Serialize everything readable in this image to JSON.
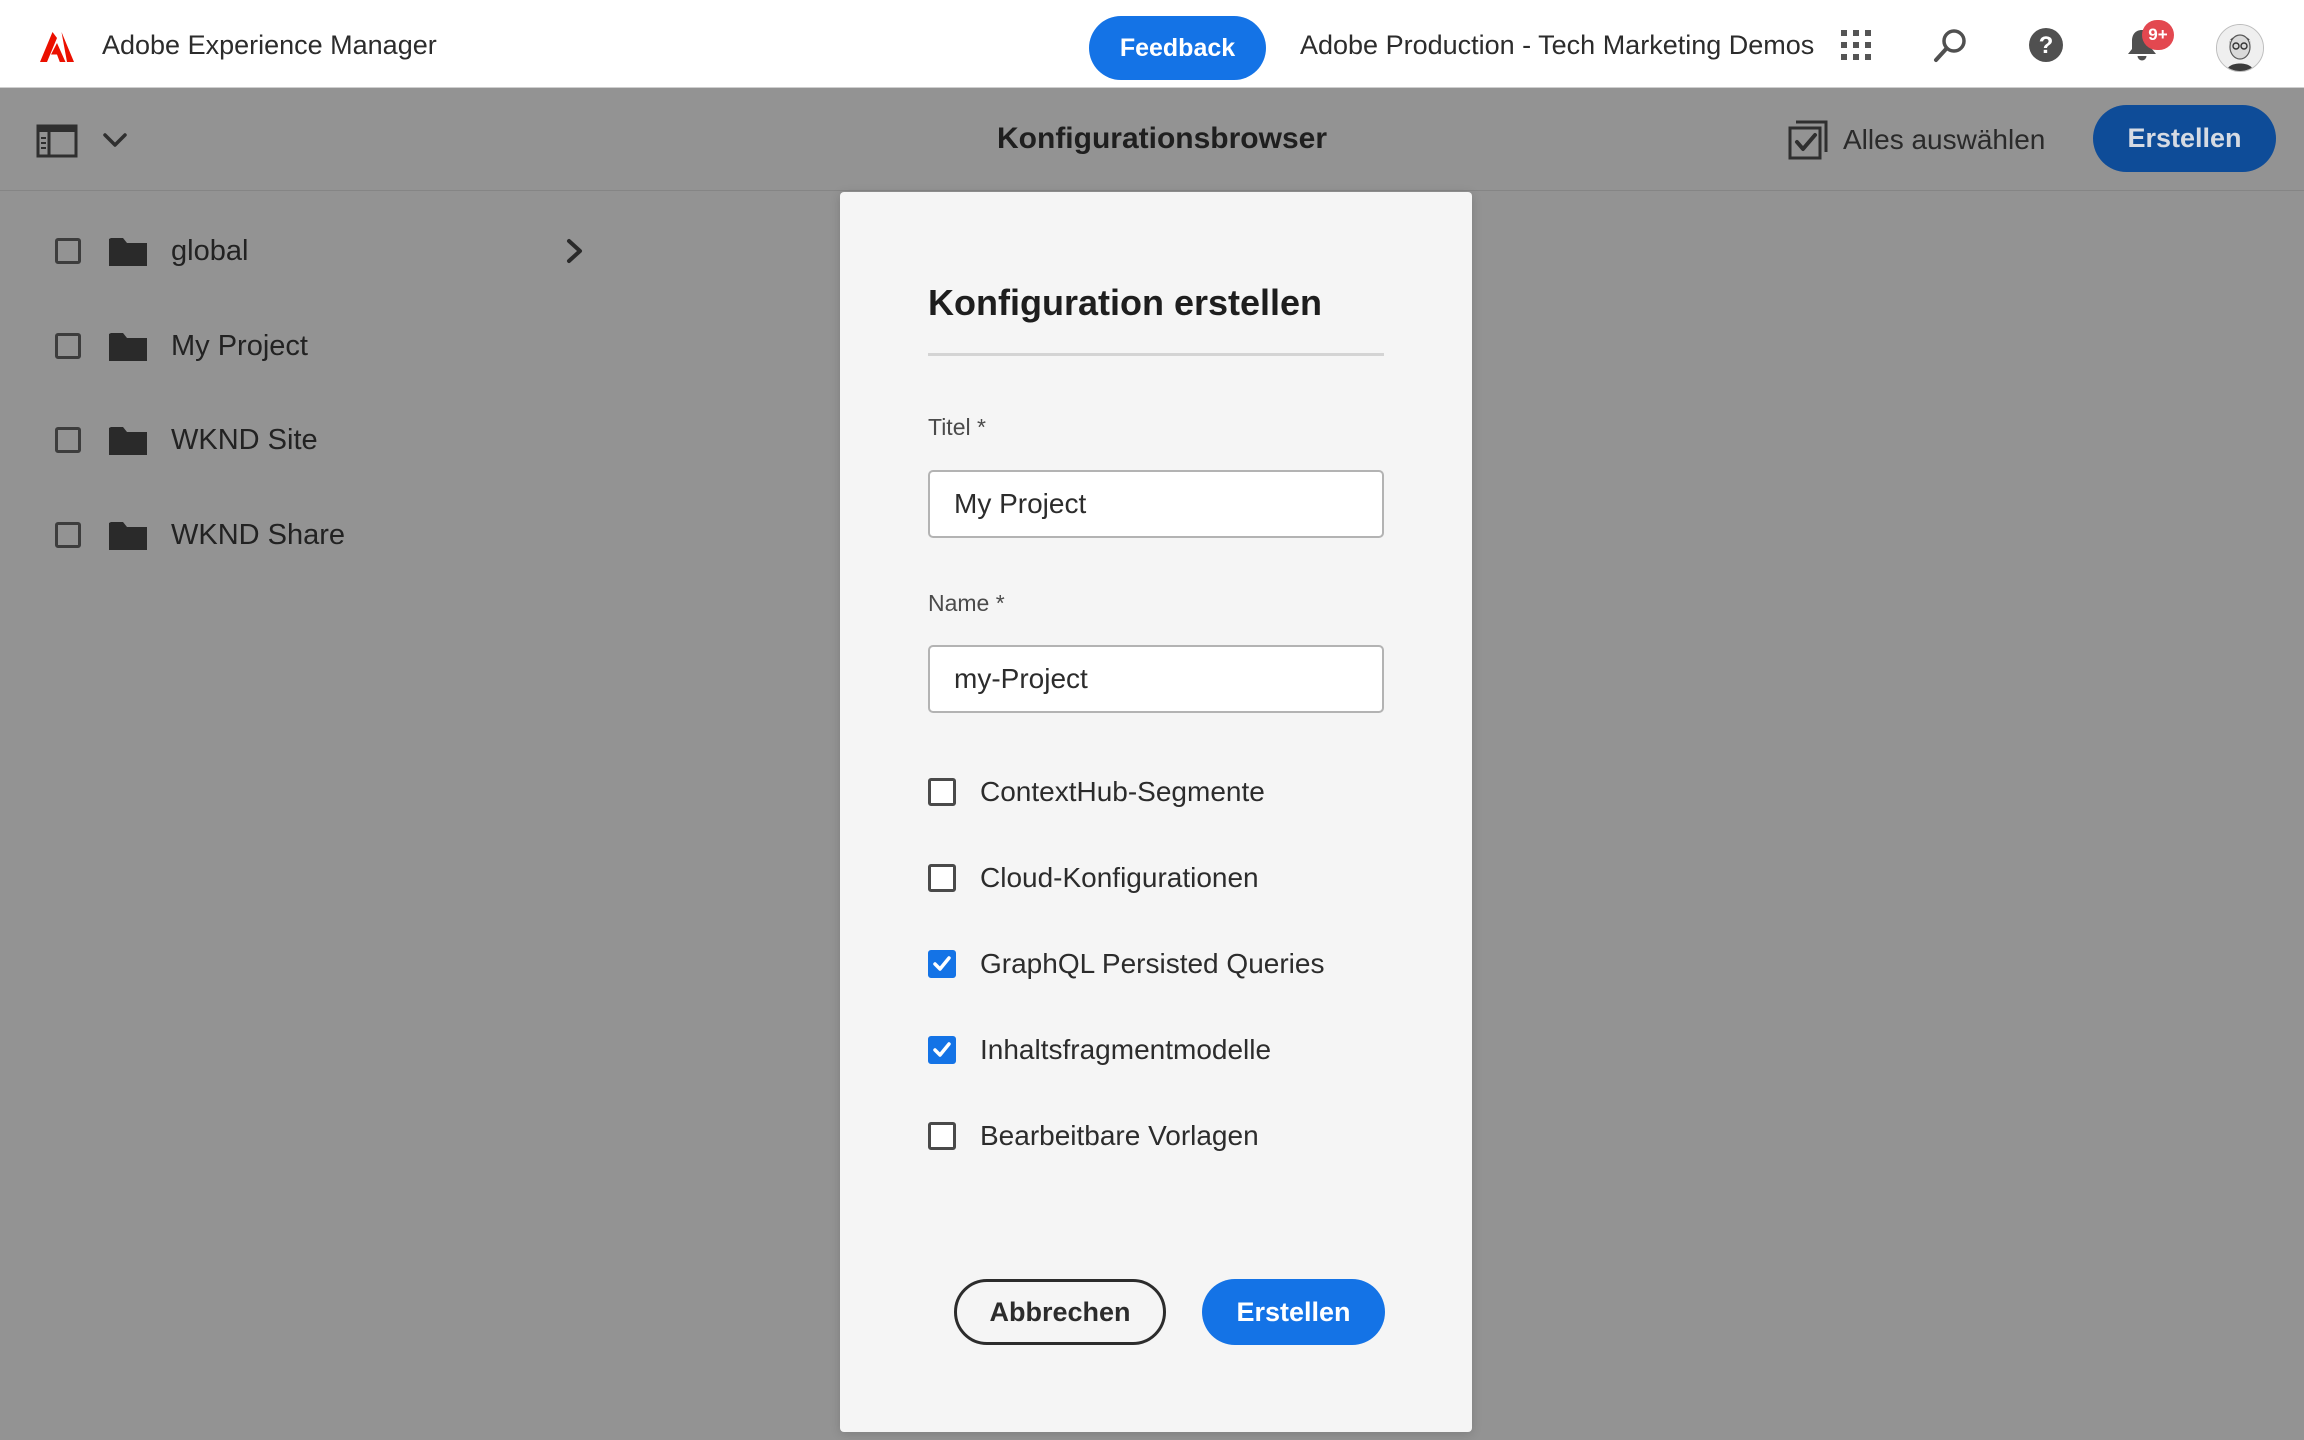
{
  "header": {
    "app_title": "Adobe Experience Manager",
    "feedback_label": "Feedback",
    "org_name": "Adobe Production - Tech Marketing Demos",
    "notification_count": "9+",
    "icons": [
      "adobe-logo",
      "apps-grid-icon",
      "search-icon",
      "help-icon",
      "bell-icon",
      "avatar"
    ]
  },
  "actionbar": {
    "title": "Konfigurationsbrowser",
    "select_all_label": "Alles auswählen",
    "create_label": "Erstellen"
  },
  "configs": [
    {
      "label": "global",
      "has_children": true,
      "checked": false
    },
    {
      "label": "My Project",
      "has_children": false,
      "checked": false
    },
    {
      "label": "WKND Site",
      "has_children": false,
      "checked": false
    },
    {
      "label": "WKND Share",
      "has_children": false,
      "checked": false
    }
  ],
  "dialog": {
    "title": "Konfiguration erstellen",
    "title_field": {
      "label": "Titel *",
      "value": "My Project"
    },
    "name_field": {
      "label": "Name *",
      "value": "my-Project"
    },
    "options": [
      {
        "label": "ContextHub-Segmente",
        "checked": false
      },
      {
        "label": "Cloud-Konfigurationen",
        "checked": false
      },
      {
        "label": "GraphQL Persisted Queries",
        "checked": true
      },
      {
        "label": "Inhaltsfragmentmodelle",
        "checked": true
      },
      {
        "label": "Bearbeitbare Vorlagen",
        "checked": false
      }
    ],
    "cancel_label": "Abbrechen",
    "create_label": "Erstellen"
  },
  "colors": {
    "accent": "#1473e6",
    "create_top_btn": "#0e4c98",
    "badge": "#e34850",
    "overlay": "#939393",
    "adobe_red": "#eb1000"
  }
}
